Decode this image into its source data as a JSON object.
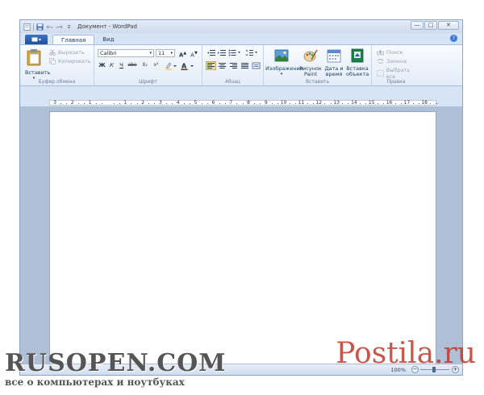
{
  "window": {
    "title": "Документ - WordPad"
  },
  "titlebar_buttons": {
    "minimize": "—",
    "maximize": "□",
    "close": "✕"
  },
  "tabs": {
    "file": "▾",
    "home": "Главная",
    "view": "Вид"
  },
  "clipboard": {
    "paste": "Вставить",
    "cut": "Вырезать",
    "copy": "Копировать",
    "group_label": "Буфер обмена"
  },
  "font": {
    "family": "Calibri",
    "size": "11",
    "bold": "Ж",
    "italic": "К",
    "underline": "Ч",
    "strike": "abe",
    "subscript": "X₂",
    "superscript": "x²",
    "group_label": "Шрифт"
  },
  "paragraph": {
    "group_label": "Абзац"
  },
  "insert": {
    "picture": "Изображение",
    "paint_line1": "Рисунок",
    "paint_line2": "Paint",
    "datetime_line1": "Дата и",
    "datetime_line2": "время",
    "object_line1": "Вставка",
    "object_line2": "объекта",
    "group_label": "Вставить"
  },
  "editing": {
    "find": "Поиск",
    "replace": "Замена",
    "select_all": "Выбрать все",
    "group_label": "Правка"
  },
  "ruler": {
    "labels": [
      "3",
      "2",
      "1",
      "",
      "1",
      "2",
      "3",
      "4",
      "5",
      "6",
      "7",
      "8",
      "9",
      "10",
      "11",
      "12",
      "13",
      "14",
      "15",
      "16",
      "17",
      "18"
    ]
  },
  "status": {
    "zoom": "100%"
  },
  "watermarks": {
    "left_big": "RUSOPEN.COM",
    "left_small": "все о компьютерах и ноутбуках",
    "right": "Postila.ru"
  },
  "colors": {
    "accent": "#1f4e9c",
    "ribbon_bg": "#e3ecf7",
    "workspace": "#aebfd6",
    "watermark_red": "#c0392b"
  }
}
